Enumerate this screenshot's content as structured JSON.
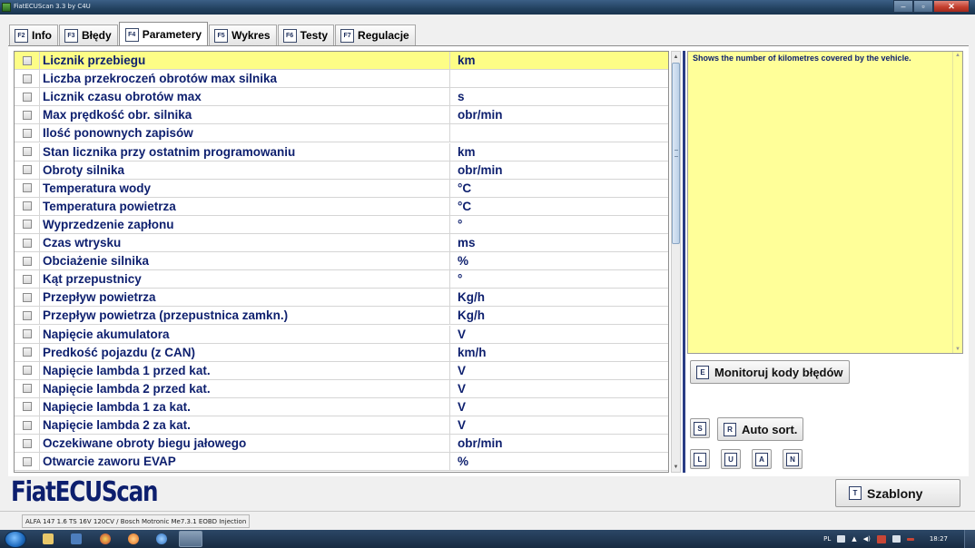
{
  "window": {
    "title": "FiatECUScan 3.3 by C4U"
  },
  "tabs": [
    {
      "key": "F2",
      "label": "Info"
    },
    {
      "key": "F3",
      "label": "Błędy"
    },
    {
      "key": "F4",
      "label": "Parametery",
      "active": true
    },
    {
      "key": "F5",
      "label": "Wykres"
    },
    {
      "key": "F6",
      "label": "Testy"
    },
    {
      "key": "F7",
      "label": "Regulacje"
    }
  ],
  "parameters": [
    {
      "name": "Licznik przebiegu",
      "unit": "km"
    },
    {
      "name": "Liczba przekroczeń obrotów max silnika",
      "unit": ""
    },
    {
      "name": "Licznik czasu obrotów max",
      "unit": "s"
    },
    {
      "name": "Max prędkość obr. silnika",
      "unit": "obr/min"
    },
    {
      "name": "Ilość ponownych zapisów",
      "unit": ""
    },
    {
      "name": "Stan licznika przy ostatnim programowaniu",
      "unit": "km"
    },
    {
      "name": "Obroty silnika",
      "unit": "obr/min"
    },
    {
      "name": "Temperatura wody",
      "unit": "°C"
    },
    {
      "name": "Temperatura powietrza",
      "unit": "°C"
    },
    {
      "name": "Wyprzedzenie zapłonu",
      "unit": "°"
    },
    {
      "name": "Czas wtrysku",
      "unit": "ms"
    },
    {
      "name": "Obciażenie silnika",
      "unit": "%"
    },
    {
      "name": "Kąt przepustnicy",
      "unit": "°"
    },
    {
      "name": "Przepływ powietrza",
      "unit": "Kg/h"
    },
    {
      "name": "Przepływ powietrza (przepustnica zamkn.)",
      "unit": "Kg/h"
    },
    {
      "name": "Napięcie akumulatora",
      "unit": "V"
    },
    {
      "name": "Predkość pojazdu (z CAN)",
      "unit": "km/h"
    },
    {
      "name": "Napięcie lambda 1 przed kat.",
      "unit": "V"
    },
    {
      "name": "Napięcie lambda 2 przed kat.",
      "unit": "V"
    },
    {
      "name": "Napięcie lambda 1 za kat.",
      "unit": "V"
    },
    {
      "name": "Napięcie lambda 2 za kat.",
      "unit": "V"
    },
    {
      "name": "Oczekiwane obroty biegu jałowego",
      "unit": "obr/min"
    },
    {
      "name": "Otwarcie zaworu EVAP",
      "unit": "%"
    }
  ],
  "description": "Shows the number of kilometres covered by the vehicle.",
  "buttons": {
    "monitor_key": "E",
    "monitor_label": "Monitoruj kody błędów",
    "s_key": "S",
    "r_key": "R",
    "autosort_label": "Auto sort.",
    "l_key": "L",
    "u_key": "U",
    "a_key": "A",
    "n_key": "N",
    "templates_key": "T",
    "templates_label": "Szablony"
  },
  "brand": "FiatECUScan",
  "status": {
    "vehicle": "ALFA 147 1.6 TS 16V 120CV / Bosch Motronic Me7.3.1 EOBD Injection"
  },
  "taskbar": {
    "language": "PL",
    "clock": "18:27"
  },
  "colors": {
    "selected_row": "#fdfd86",
    "description_bg": "#ffff99",
    "text_blue": "#0d1f6e",
    "splitter": "#2a3d85"
  }
}
